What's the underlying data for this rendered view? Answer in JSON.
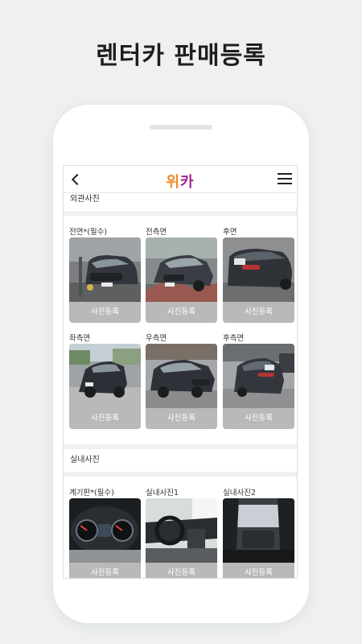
{
  "promo": {
    "title": "렌터카 판매등록"
  },
  "header": {
    "logo_part1": "위",
    "logo_part2": "카"
  },
  "exterior": {
    "title": "외관사진",
    "items": [
      {
        "label": "전면*(필수)",
        "button": "사진등록"
      },
      {
        "label": "전측면",
        "button": "사진등록"
      },
      {
        "label": "후면",
        "button": "사진등록"
      },
      {
        "label": "좌측면",
        "button": "사진등록"
      },
      {
        "label": "우측면",
        "button": "사진등록"
      },
      {
        "label": "후측면",
        "button": "사진등록"
      }
    ]
  },
  "interior": {
    "title": "실내사진",
    "items": [
      {
        "label": "계기판*(필수)",
        "button": "사진등록"
      },
      {
        "label": "실내사진1",
        "button": "사진등록"
      },
      {
        "label": "실내사진2",
        "button": "사진등록"
      }
    ]
  },
  "colors": {
    "brand_orange": "#f28a1e",
    "brand_purple": "#a3248f",
    "button_gray": "#b9b9b9"
  }
}
